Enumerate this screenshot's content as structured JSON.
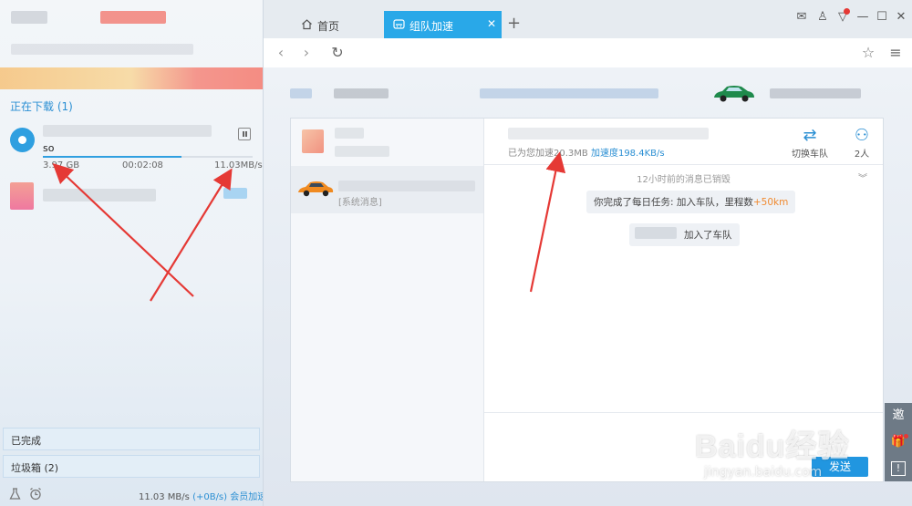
{
  "left_panel": {
    "section_title": "正在下载 (1)",
    "download": {
      "name": "so",
      "progress": 0.66,
      "size": "3.97 GB",
      "elapsed": "00:02:08",
      "speed": "11.03MB/s"
    },
    "completed_label": "已完成",
    "trash_label": "垃圾箱 (2)",
    "bottom": {
      "speed": "11.03 MB/s",
      "extra": "(+0B/s)",
      "vip_label": "会员加速"
    }
  },
  "tabs": [
    {
      "label": "首页",
      "icon": "home-icon"
    },
    {
      "label": "组队加速",
      "icon": "car-icon",
      "active": true
    }
  ],
  "team_panel": {
    "system_tag": "[系统消息]",
    "accel_prefix": "已为您加速20.3MB",
    "accel_speed": "加速度198.4KB/s",
    "switch_team_label": "切换车队",
    "members_label": "2人",
    "notice": "12小时前的消息已销毁",
    "bubble1_text": "你完成了每日任务: 加入车队，里程数",
    "bubble1_bonus": "+50km",
    "bubble2_text": "加入了车队",
    "send_label": "发送"
  },
  "side_strip": {
    "invite": "邀",
    "feedback": "!"
  },
  "watermark": {
    "main": "Baidu经验",
    "sub": "jingyan.baidu.com"
  },
  "colors": {
    "accent": "#29a8e8",
    "arrow": "#e53935",
    "bonus": "#f08a30"
  }
}
